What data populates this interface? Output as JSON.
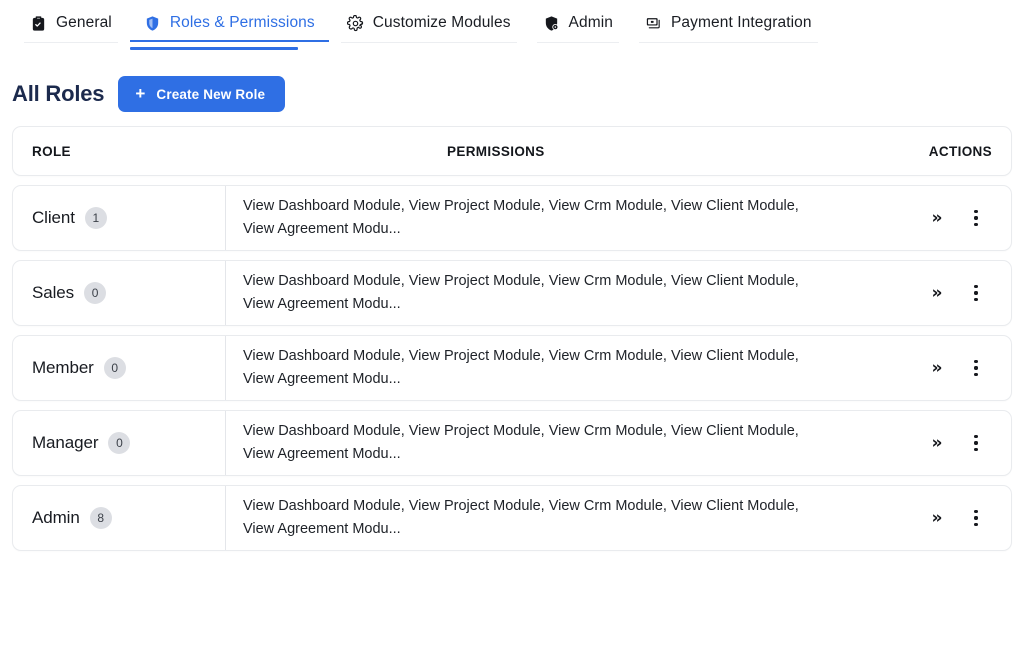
{
  "tabs": [
    {
      "label": "General",
      "icon": "clipboard-check-icon",
      "active": false
    },
    {
      "label": "Roles & Permissions",
      "icon": "shield-icon",
      "active": true
    },
    {
      "label": "Customize Modules",
      "icon": "gear-icon",
      "active": false
    },
    {
      "label": "Admin",
      "icon": "shield-gear-icon",
      "active": false
    },
    {
      "label": "Payment Integration",
      "icon": "banknote-icon",
      "active": false
    }
  ],
  "header": {
    "page_title": "All Roles",
    "create_button_label": "Create New Role",
    "create_button_plus": "+"
  },
  "table": {
    "columns": {
      "role": "ROLE",
      "permissions": "PERMISSIONS",
      "actions": "ACTIONS"
    },
    "rows": [
      {
        "role": "Client",
        "count": "1",
        "permissions": "View Dashboard Module, View Project Module, View Crm Module, View Client Module, View Agreement Modu..."
      },
      {
        "role": "Sales",
        "count": "0",
        "permissions": "View Dashboard Module, View Project Module, View Crm Module, View Client Module, View Agreement Modu..."
      },
      {
        "role": "Member",
        "count": "0",
        "permissions": "View Dashboard Module, View Project Module, View Crm Module, View Client Module, View Agreement Modu..."
      },
      {
        "role": "Manager",
        "count": "0",
        "permissions": "View Dashboard Module, View Project Module, View Crm Module, View Client Module, View Agreement Modu..."
      },
      {
        "role": "Admin",
        "count": "8",
        "permissions": "View Dashboard Module, View Project Module, View Crm Module, View Client Module, View Agreement Modu..."
      }
    ],
    "row_actions": {
      "expand_glyph": "»",
      "expand_name": "expand-row-button",
      "menu_name": "row-menu-button"
    }
  },
  "colors": {
    "accent": "#2f6fe4",
    "title": "#1c2a4d",
    "badge_bg": "#dcdee3",
    "border": "#e9ebee"
  }
}
